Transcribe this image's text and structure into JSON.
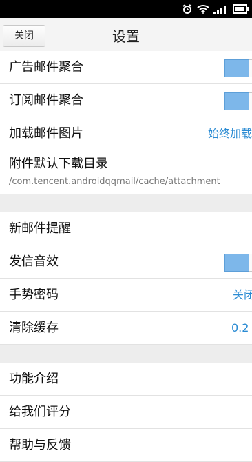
{
  "header": {
    "close_label": "关闭",
    "title": "设置"
  },
  "section1": [
    {
      "label": "广告邮件聚合",
      "toggle": true
    },
    {
      "label": "订阅邮件聚合",
      "toggle": true
    },
    {
      "label": "加载邮件图片",
      "value": "始终加载"
    },
    {
      "label": "附件默认下载目录",
      "sub": "/com.tencent.androidqqmail/cache/attachment"
    }
  ],
  "section2": [
    {
      "label": "新邮件提醒"
    },
    {
      "label": "发信音效",
      "toggle": true
    },
    {
      "label": "手势密码",
      "value": "关闭"
    },
    {
      "label": "清除缓存",
      "value": "0.2"
    }
  ],
  "section3": [
    {
      "label": "功能介绍"
    },
    {
      "label": "给我们评分"
    },
    {
      "label": "帮助与反馈"
    }
  ],
  "colors": {
    "accent": "#2a8bd3",
    "toggle_on": "#7db7ea"
  }
}
